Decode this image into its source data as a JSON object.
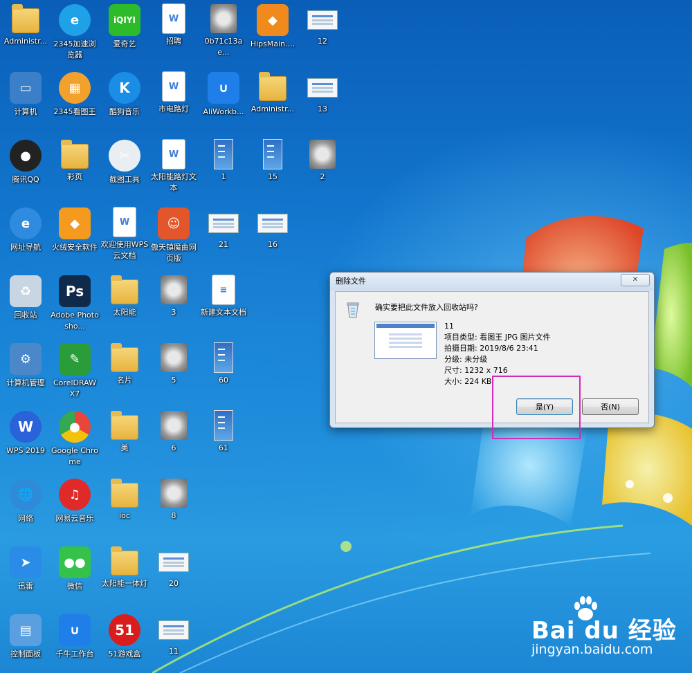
{
  "desktop": {
    "icons": [
      {
        "label": "Administr...",
        "icon": "user-folder-icon"
      },
      {
        "label": "2345加速浏览器",
        "icon": "browser-e-icon"
      },
      {
        "label": "爱奇艺",
        "icon": "iqiyi-icon",
        "badge": "iQIYI"
      },
      {
        "label": "招聘",
        "icon": "wps-doc-icon"
      },
      {
        "label": "0b71c13ae...",
        "icon": "image-thumb-icon"
      },
      {
        "label": "HipsMain....",
        "icon": "shield-icon"
      },
      {
        "label": "12",
        "icon": "screenshot-thumb-icon"
      },
      {
        "label": "计算机",
        "icon": "computer-icon"
      },
      {
        "label": "2345看图王",
        "icon": "image-viewer-icon"
      },
      {
        "label": "酷狗音乐",
        "icon": "kugou-icon",
        "badge": "K"
      },
      {
        "label": "市电路灯",
        "icon": "wps-doc-icon"
      },
      {
        "label": "AliWorkb...",
        "icon": "aliworkbench-icon"
      },
      {
        "label": "Administr...",
        "icon": "user-folder-icon"
      },
      {
        "label": "13",
        "icon": "screenshot-thumb-icon"
      },
      {
        "label": "腾讯QQ",
        "icon": "qq-icon"
      },
      {
        "label": "彩页",
        "icon": "folder-icon"
      },
      {
        "label": "截图工具",
        "icon": "snipping-tool-icon"
      },
      {
        "label": "太阳能路灯文本",
        "icon": "wps-doc-icon"
      },
      {
        "label": "1",
        "icon": "tall-screenshot-icon"
      },
      {
        "label": "15",
        "icon": "tall-screenshot-icon"
      },
      {
        "label": "2",
        "icon": "photo-thumb-icon"
      },
      {
        "label": "网址导航",
        "icon": "ie-icon"
      },
      {
        "label": "火绒安全软件",
        "icon": "huorong-icon"
      },
      {
        "label": "欢迎使用WPS云文档",
        "icon": "wps-doc-icon"
      },
      {
        "label": "傲天镇魔曲网页版",
        "icon": "game-icon"
      },
      {
        "label": "21",
        "icon": "screenshot-thumb-icon"
      },
      {
        "label": "16",
        "icon": "screenshot-thumb-icon"
      },
      {
        "label": "回收站",
        "icon": "recycle-bin-icon"
      },
      {
        "label": "Adobe Photosho...",
        "icon": "photoshop-icon",
        "badge": "Ps"
      },
      {
        "label": "太阳能",
        "icon": "folder-icon"
      },
      {
        "label": "3",
        "icon": "photo-thumb-icon"
      },
      {
        "label": "新建文本文档",
        "icon": "text-doc-icon"
      },
      {
        "label": "计算机管理",
        "icon": "computer-management-icon"
      },
      {
        "label": "CorelDRAW X7",
        "icon": "coreldraw-icon"
      },
      {
        "label": "名片",
        "icon": "folder-icon"
      },
      {
        "label": "5",
        "icon": "photo-thumb-icon"
      },
      {
        "label": "60",
        "icon": "tall-screenshot-icon"
      },
      {
        "label": "WPS 2019",
        "icon": "wps-icon",
        "badge": "W"
      },
      {
        "label": "Google Chrome",
        "icon": "chrome-icon"
      },
      {
        "label": "美",
        "icon": "folder-icon"
      },
      {
        "label": "6",
        "icon": "photo-thumb-icon"
      },
      {
        "label": "61",
        "icon": "tall-screenshot-icon"
      },
      {
        "label": "网络",
        "icon": "network-icon"
      },
      {
        "label": "网易云音乐",
        "icon": "netease-music-icon"
      },
      {
        "label": "ioc",
        "icon": "folder-icon"
      },
      {
        "label": "8",
        "icon": "photo-thumb-icon"
      },
      {
        "label": "迅雷",
        "icon": "xunlei-icon"
      },
      {
        "label": "微信",
        "icon": "wechat-icon"
      },
      {
        "label": "太阳能一体灯",
        "icon": "folder-icon"
      },
      {
        "label": "20",
        "icon": "screenshot-thumb-icon"
      },
      {
        "label": "控制面板",
        "icon": "control-panel-icon"
      },
      {
        "label": "千牛工作台",
        "icon": "qianniu-icon"
      },
      {
        "label": "51游戏盒",
        "icon": "game-box-51-icon",
        "badge": "51"
      },
      {
        "label": "11",
        "icon": "screenshot-thumb-icon"
      }
    ]
  },
  "dialog": {
    "title": "删除文件",
    "close_label": "✕",
    "question": "确实要把此文件放入回收站吗?",
    "file_name": "11",
    "type_line": "项目类型: 看图王 JPG 图片文件",
    "date_line": "拍摄日期: 2019/8/6 23:41",
    "rating_line": "分级: 未分级",
    "size_dim_line": "尺寸: 1232 x 716",
    "file_size_line": "大小: 224 KB",
    "yes_label": "是(Y)",
    "no_label": "否(N)"
  },
  "watermark": {
    "brand": "Bai du 经验",
    "url": "jingyan.baidu.com"
  },
  "colors": {
    "highlight": "#d42ab8",
    "desktop_blue": "#1378cf"
  }
}
